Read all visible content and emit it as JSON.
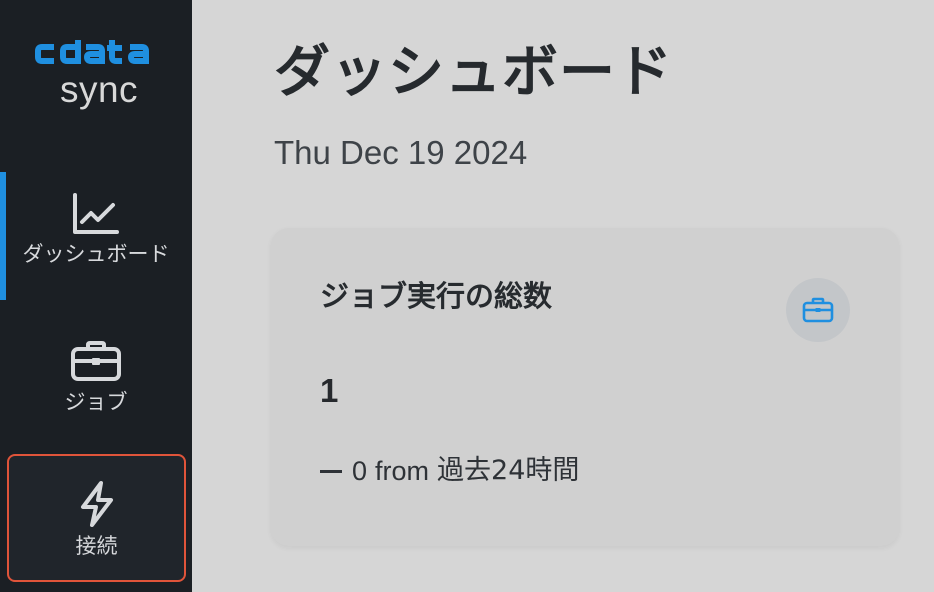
{
  "brand": {
    "logo_text": "cdata",
    "product": "sync"
  },
  "colors": {
    "sidebar_bg": "#1b1f24",
    "accent": "#1f8fe0",
    "highlight_border": "#e0543a",
    "main_bg": "#d6d6d6"
  },
  "sidebar": {
    "items": [
      {
        "label": "ダッシュボード",
        "icon": "line-chart-icon",
        "active": true
      },
      {
        "label": "ジョブ",
        "icon": "briefcase-icon",
        "active": false
      },
      {
        "label": "接続",
        "icon": "lightning-icon",
        "active": false,
        "highlighted": true
      }
    ]
  },
  "main": {
    "title": "ダッシュボード",
    "date": "Thu Dec 19 2024",
    "card": {
      "title": "ジョブ実行の総数",
      "icon": "briefcase-icon",
      "value": "1",
      "change_value": "0",
      "change_from": "from",
      "change_period": "過去24時間"
    }
  }
}
